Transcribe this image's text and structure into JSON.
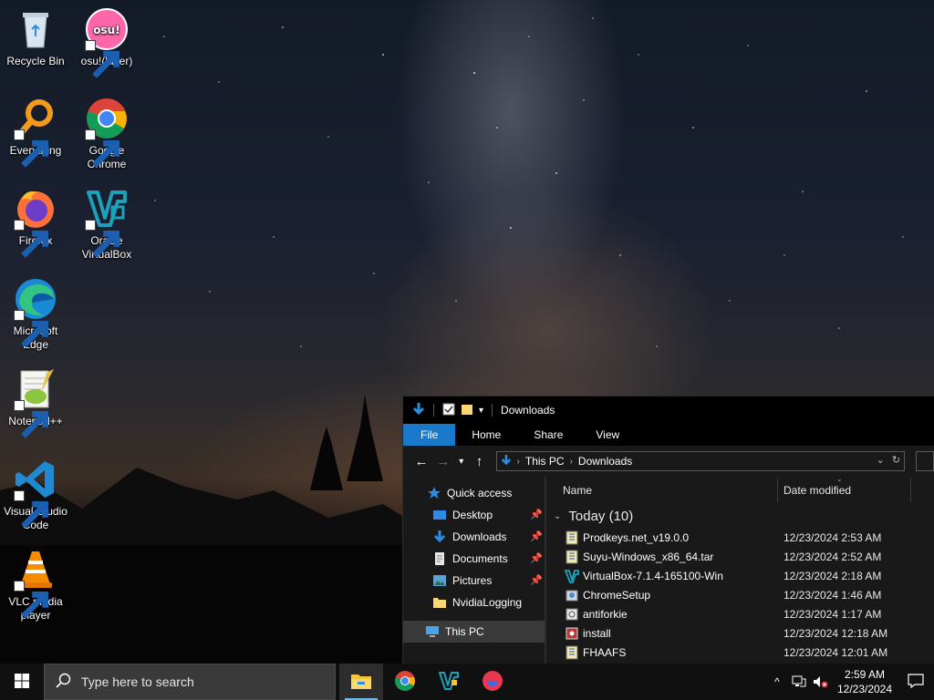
{
  "desktop": {
    "icons": [
      {
        "label": "Recycle Bin",
        "icon": "recycle-bin-icon"
      },
      {
        "label": "osu!(lazer)",
        "icon": "osu-icon",
        "badge": "osu!"
      },
      {
        "label": "Everything",
        "icon": "everything-search-icon"
      },
      {
        "label": "Google Chrome",
        "icon": "chrome-icon"
      },
      {
        "label": "Firefox",
        "icon": "firefox-icon"
      },
      {
        "label": "Oracle VirtualBox",
        "icon": "virtualbox-icon"
      },
      {
        "label": "Microsoft Edge",
        "icon": "edge-icon"
      },
      {
        "label": "Notepad++",
        "icon": "notepadpp-icon"
      },
      {
        "label": "Visual Studio Code",
        "icon": "vscode-icon"
      },
      {
        "label": "VLC media player",
        "icon": "vlc-icon"
      }
    ]
  },
  "explorer": {
    "title": "Downloads",
    "ribbon_tabs": [
      "File",
      "Home",
      "Share",
      "View"
    ],
    "address": {
      "crumbs": [
        "This PC",
        "Downloads"
      ]
    },
    "nav": {
      "quick_access": "Quick access",
      "items": [
        {
          "label": "Desktop",
          "pinned": true
        },
        {
          "label": "Downloads",
          "pinned": true
        },
        {
          "label": "Documents",
          "pinned": true
        },
        {
          "label": "Pictures",
          "pinned": true
        },
        {
          "label": "NvidiaLogging",
          "pinned": false
        }
      ],
      "this_pc": "This PC"
    },
    "columns": {
      "name": "Name",
      "date": "Date modified"
    },
    "group": "Today (10)",
    "files": [
      {
        "name": "Prodkeys.net_v19.0.0",
        "date": "12/23/2024 2:53 AM",
        "icon": "archive-icon"
      },
      {
        "name": "Suyu-Windows_x86_64.tar",
        "date": "12/23/2024 2:52 AM",
        "icon": "archive-icon"
      },
      {
        "name": "VirtualBox-7.1.4-165100-Win",
        "date": "12/23/2024 2:18 AM",
        "icon": "virtualbox-installer-icon"
      },
      {
        "name": "ChromeSetup",
        "date": "12/23/2024 1:46 AM",
        "icon": "setup-icon"
      },
      {
        "name": "antiforkie",
        "date": "12/23/2024 1:17 AM",
        "icon": "file-icon"
      },
      {
        "name": "install",
        "date": "12/23/2024 12:18 AM",
        "icon": "installer-icon"
      },
      {
        "name": "FHAAFS",
        "date": "12/23/2024 12:01 AM",
        "icon": "archive-icon"
      }
    ]
  },
  "taskbar": {
    "search_placeholder": "Type here to search",
    "apps": [
      "file-explorer-icon",
      "chrome-icon",
      "virtualbox-icon",
      "osu-icon"
    ],
    "clock": {
      "time": "2:59 AM",
      "date": "12/23/2024"
    }
  },
  "colors": {
    "accent": "#1979ca",
    "taskbar": "#101010",
    "explorer_bg": "#191919"
  }
}
